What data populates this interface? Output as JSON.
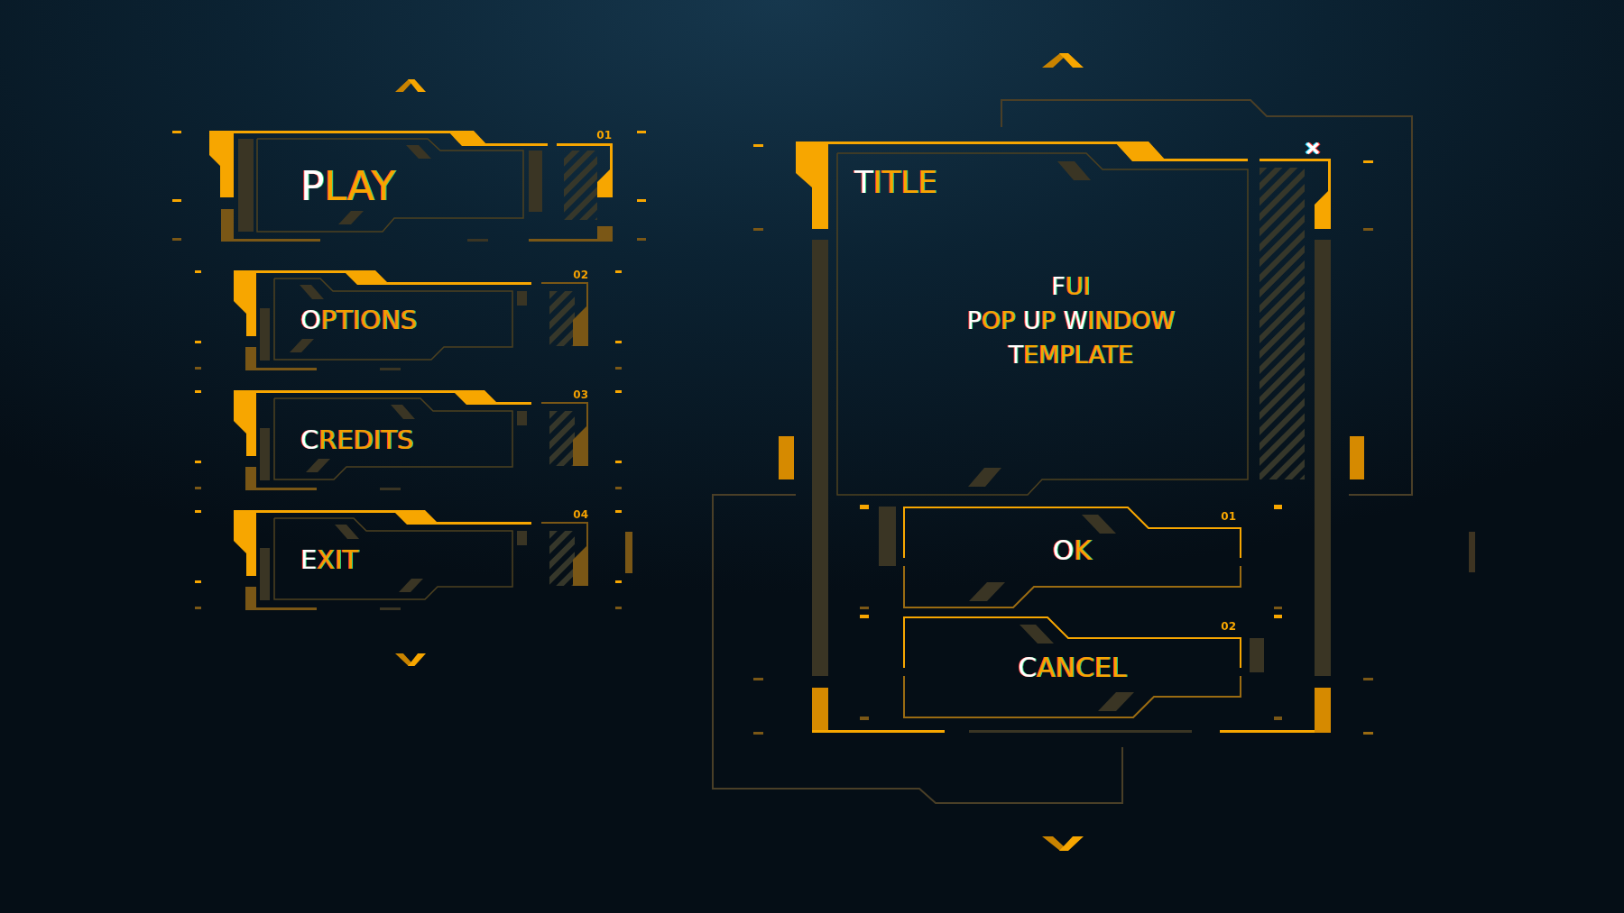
{
  "menu": {
    "items": [
      {
        "label": "PLAY",
        "number": "01",
        "selected": true
      },
      {
        "label": "OPTIONS",
        "number": "02",
        "selected": false
      },
      {
        "label": "CREDITS",
        "number": "03",
        "selected": false
      },
      {
        "label": "EXIT",
        "number": "04",
        "selected": false
      }
    ]
  },
  "popup": {
    "title": "TITLE",
    "message_lines": [
      "FUI",
      "POP UP WINDOW",
      "TEMPLATE"
    ],
    "buttons": [
      {
        "label": "OK",
        "number": "01"
      },
      {
        "label": "CANCEL",
        "number": "02"
      }
    ]
  }
}
